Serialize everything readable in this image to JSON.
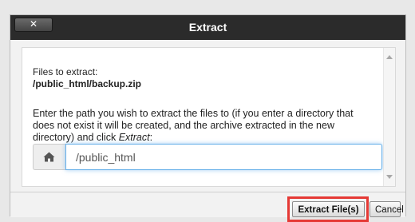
{
  "dialog": {
    "title": "Extract",
    "close_label": "✕"
  },
  "content": {
    "files_label": "Files to extract:",
    "files_path": "/public_html/backup.zip",
    "instructions_text": "Enter the path you wish to extract the files to (if you enter a directory that does not exist it will be created, and the archive extracted in the new directory) and click ",
    "instructions_emphasis": "Extract",
    "instructions_end": ":",
    "path_input_value": "/public_html"
  },
  "footer": {
    "extract_label": "Extract File(s)",
    "cancel_label": "Cancel"
  },
  "colors": {
    "titlebar": "#2b2b2b",
    "highlight": "#e53935",
    "input_focus": "#66afe9"
  },
  "icons": {
    "home": "home-icon",
    "close": "close-icon"
  }
}
